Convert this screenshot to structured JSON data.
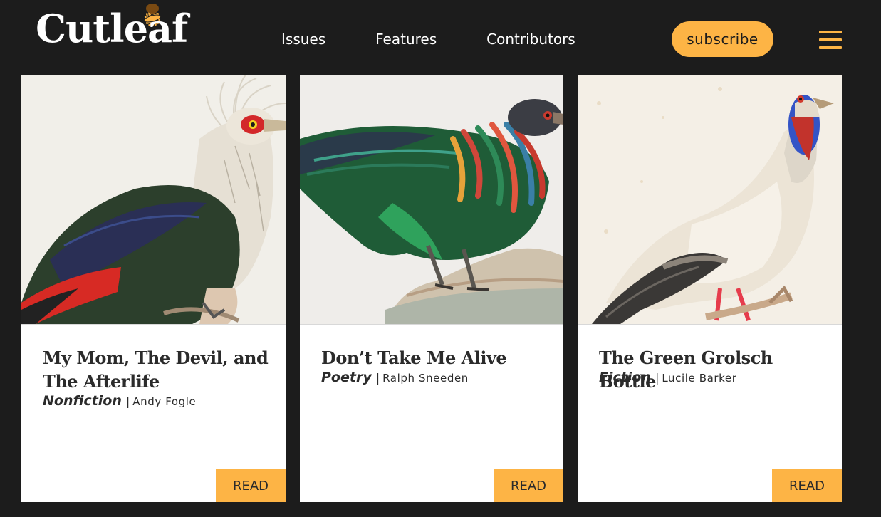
{
  "brand": {
    "name": "Cutleaf",
    "accent": "#fdb445",
    "background": "#1c1c1c"
  },
  "nav": {
    "items": [
      {
        "label": "Issues"
      },
      {
        "label": "Features"
      },
      {
        "label": "Contributors"
      }
    ],
    "subscribe_label": "subscribe",
    "menu_icon": "hamburger-menu-icon"
  },
  "cards": [
    {
      "title": "My Mom, The Devil, and The Afterlife",
      "genre": "Nonfiction",
      "separator": "|",
      "author": "Andy Fogle",
      "read_label": "READ",
      "image": "crested-bird-illustration"
    },
    {
      "title": "Don’t Take Me Alive",
      "genre": "Poetry",
      "separator": "|",
      "author": "Ralph Sneeden",
      "read_label": "READ",
      "image": "iridescent-bird-illustration"
    },
    {
      "title": "The Green Grolsch Bottle",
      "genre": "Fiction",
      "separator": "|",
      "author": "Lucile Barker",
      "read_label": "READ",
      "image": "white-vulture-illustration"
    }
  ]
}
